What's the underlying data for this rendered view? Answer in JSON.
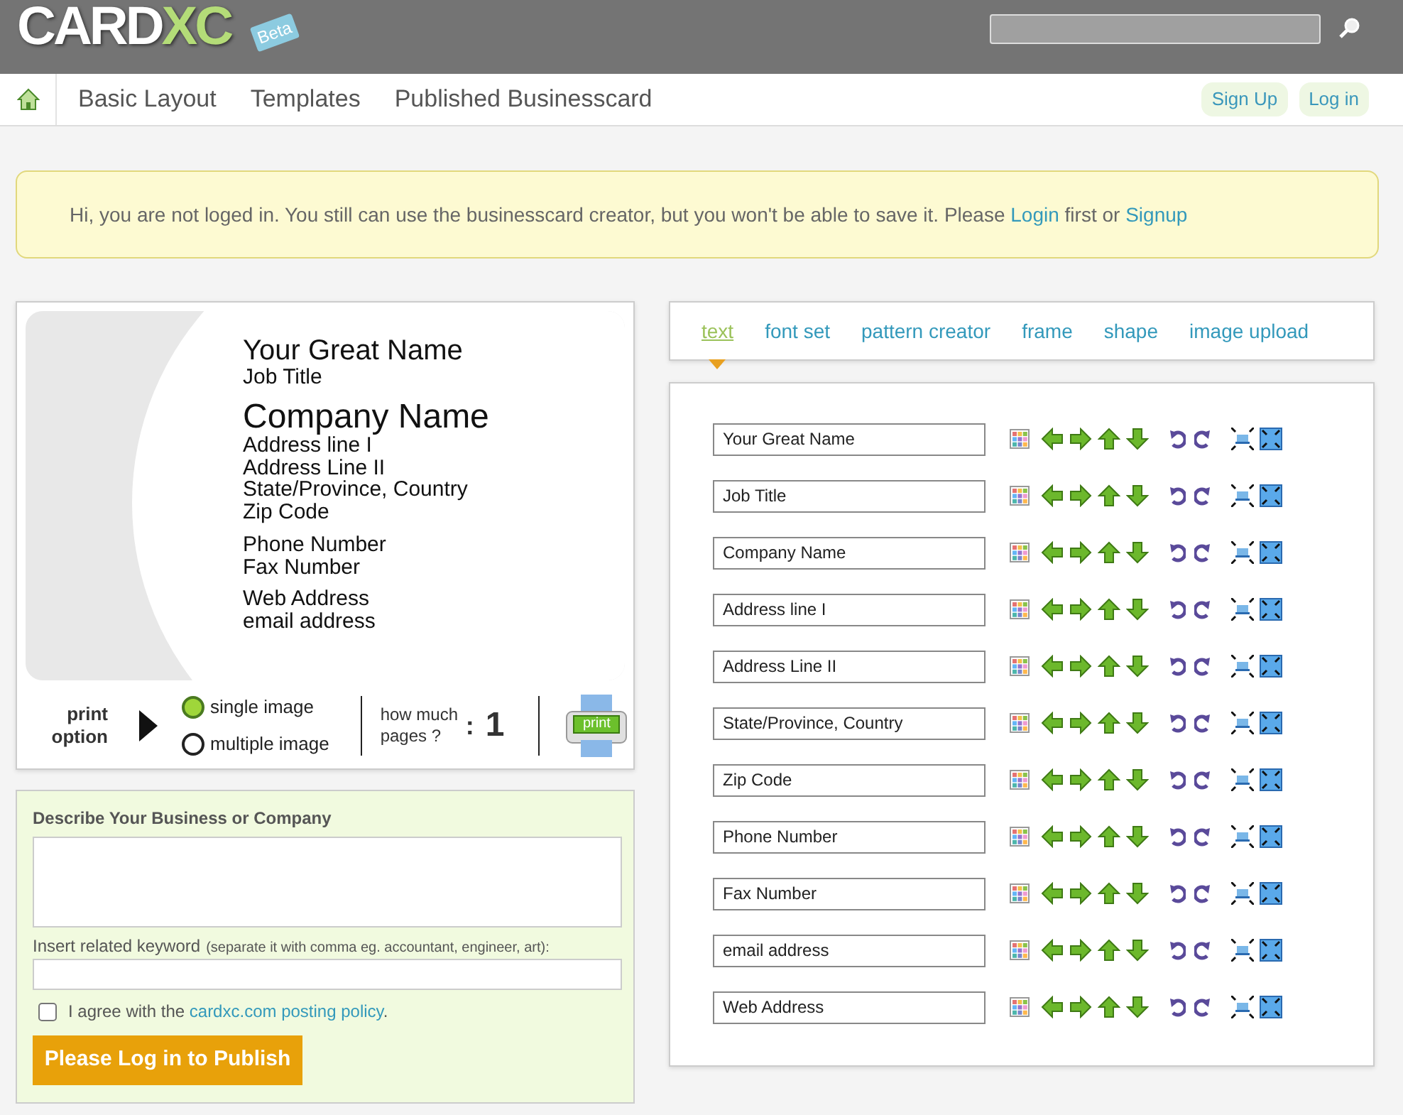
{
  "header": {
    "logo": "CARD",
    "logo_accent": "XC",
    "logo_badge": "Beta"
  },
  "nav": {
    "items": [
      {
        "label": "Basic Layout"
      },
      {
        "label": "Templates"
      },
      {
        "label": "Published Businesscard"
      }
    ],
    "actions": [
      {
        "label": "Sign Up"
      },
      {
        "label": "Log in"
      }
    ]
  },
  "notice": {
    "parts": [
      {
        "kind": "text",
        "text": "Hi, you are not loged in. You still can use the businesscard creator, but you won't be able to save it. Please "
      },
      {
        "kind": "link",
        "text": "Login"
      },
      {
        "kind": "text",
        "text": " first or "
      },
      {
        "kind": "link",
        "text": "Signup"
      }
    ]
  },
  "card_preview": {
    "blocks": [
      [
        {
          "kind": "name",
          "text": "Your Great Name"
        },
        {
          "kind": "detail",
          "text": "Job Title"
        }
      ],
      [
        {
          "kind": "company",
          "text": "Company Name"
        },
        {
          "kind": "detail",
          "text": "Address line I"
        },
        {
          "kind": "detail",
          "text": "Address Line II"
        },
        {
          "kind": "detail",
          "text": "State/Province, Country"
        },
        {
          "kind": "detail",
          "text": "Zip Code"
        }
      ],
      [
        {
          "kind": "detail",
          "text": "Phone Number"
        },
        {
          "kind": "detail",
          "text": "Fax Number"
        }
      ],
      [
        {
          "kind": "detail",
          "text": "Web Address"
        },
        {
          "kind": "detail",
          "text": "email address"
        }
      ]
    ]
  },
  "print_options": {
    "label": "print option",
    "choices": [
      {
        "label": "single image",
        "selected": true
      },
      {
        "label": "multiple image",
        "selected": false
      }
    ],
    "pages_label": "how much pages ?",
    "pages_separator": ":",
    "pages": "1",
    "print_button": "print"
  },
  "editor": {
    "tabs": [
      {
        "label": "text",
        "selected": true
      },
      {
        "label": "font set",
        "selected": false
      },
      {
        "label": "pattern creator",
        "selected": false
      },
      {
        "label": "frame",
        "selected": false
      },
      {
        "label": "shape",
        "selected": false
      },
      {
        "label": "image upload",
        "selected": false
      }
    ],
    "fields": [
      {
        "value": "Your Great Name"
      },
      {
        "value": "Job Title"
      },
      {
        "value": "Company Name"
      },
      {
        "value": "Address line I"
      },
      {
        "value": "Address Line II"
      },
      {
        "value": "State/Province, Country"
      },
      {
        "value": "Zip Code"
      },
      {
        "value": "Phone Number"
      },
      {
        "value": "Fax Number"
      },
      {
        "value": "email address"
      },
      {
        "value": "Web Address"
      }
    ]
  },
  "publish_form": {
    "describe_label": "Describe Your Business or Company",
    "keyword_label": "Insert related keyword",
    "keyword_hint": "(separate it with comma eg. accountant, engineer, art):",
    "agree_checked": false,
    "agree_parts": [
      {
        "kind": "text",
        "text": "I agree with the "
      },
      {
        "kind": "link",
        "text": "cardxc.com posting policy"
      },
      {
        "kind": "text",
        "text": "."
      }
    ],
    "button": "Please Log in to Publish"
  }
}
